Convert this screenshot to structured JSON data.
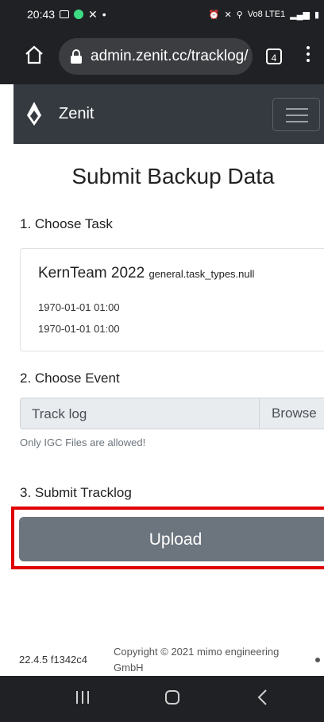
{
  "status_bar": {
    "time": "20:43",
    "left_icons": [
      "gallery-icon",
      "notification-dot-icon",
      "phone-missed-icon",
      "dot-icon"
    ],
    "right_icons": [
      "alarm-icon",
      "mute-icon",
      "location-icon",
      "wifi-icon",
      "signal-icon",
      "battery-icon"
    ],
    "network_label": "Vo8 LTE1"
  },
  "browser": {
    "url": "admin.zenit.cc/tracklog/",
    "tab_count": "4"
  },
  "navbar": {
    "brand": "Zenit"
  },
  "page": {
    "title": "Submit Backup Data",
    "step1_label": "1. Choose Task",
    "task": {
      "name": "KernTeam 2022",
      "type": "general.task_types.null",
      "start": "1970-01-01 01:00",
      "end": "1970-01-01 01:00"
    },
    "step2_label": "2. Choose Event",
    "file_input": {
      "placeholder": "Track log",
      "browse_label": "Browse"
    },
    "hint": "Only IGC Files are allowed!",
    "step3_label": "3. Submit Tracklog",
    "upload_label": "Upload"
  },
  "footer": {
    "version": "22.4.5 f1342c4",
    "copyright": "Copyright © 2021 mimo engineering GmbH"
  },
  "colors": {
    "navbar": "#343a40",
    "upload_button": "#6c757d",
    "highlight": "#e00000",
    "browser_chrome": "#202124"
  }
}
